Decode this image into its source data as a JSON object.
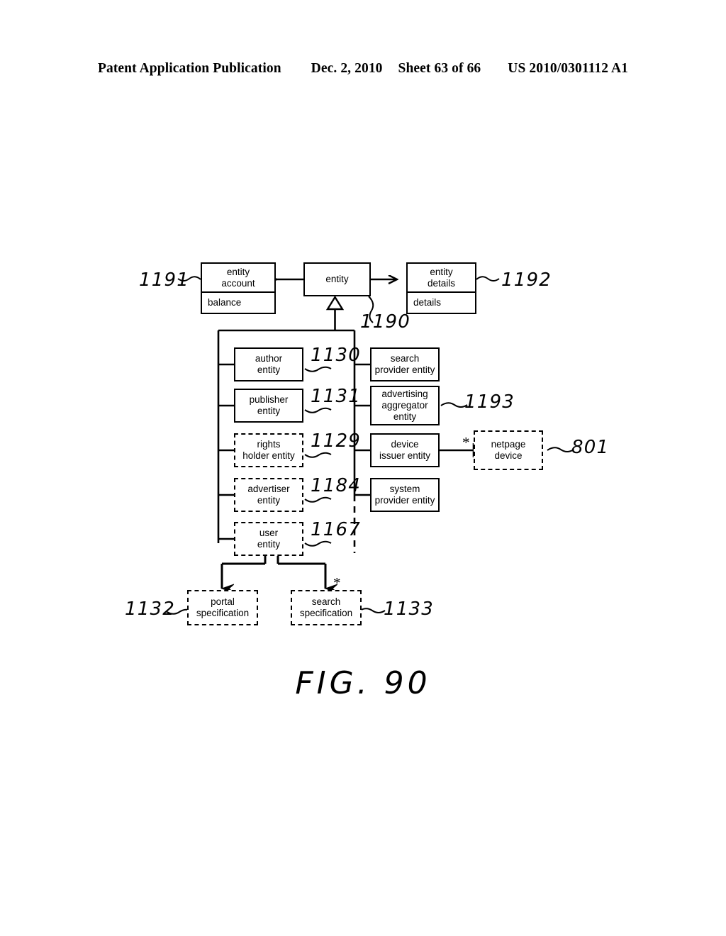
{
  "page_header": {
    "publication": "Patent Application Publication",
    "date": "Dec. 2, 2010",
    "sheet": "Sheet 63 of 66",
    "doc_number": "US 2010/0301112 A1"
  },
  "figure": {
    "caption": "FIG. 90",
    "type": "uml-class-diagram",
    "nodes": [
      {
        "id": "entity_account",
        "name": "entity\naccount",
        "attribute": "balance",
        "ref": "1191",
        "style": "solid",
        "compartments": 2
      },
      {
        "id": "entity",
        "name": "entity",
        "ref": "1190",
        "style": "solid",
        "compartments": 1
      },
      {
        "id": "entity_details",
        "name": "entity\ndetails",
        "attribute": "details",
        "ref": "1192",
        "style": "solid",
        "compartments": 2
      },
      {
        "id": "author_entity",
        "name": "author\nentity",
        "ref": "1130",
        "style": "solid",
        "compartments": 1
      },
      {
        "id": "publisher_entity",
        "name": "publisher\nentity",
        "ref": "1131",
        "style": "solid",
        "compartments": 1
      },
      {
        "id": "rights_holder_entity",
        "name": "rights\nholder entity",
        "ref": "1129",
        "style": "dashed",
        "compartments": 1
      },
      {
        "id": "advertiser_entity",
        "name": "advertiser\nentity",
        "ref": "1184",
        "style": "dashed",
        "compartments": 1
      },
      {
        "id": "user_entity",
        "name": "user\nentity",
        "ref": "1167",
        "style": "dashed",
        "compartments": 1
      },
      {
        "id": "search_provider_entity",
        "name": "search\nprovider entity",
        "ref": "",
        "style": "solid",
        "compartments": 1
      },
      {
        "id": "advertising_aggregator_entity",
        "name": "advertising\naggregator\nentity",
        "ref": "1193",
        "style": "solid",
        "compartments": 1
      },
      {
        "id": "device_issuer_entity",
        "name": "device\nissuer entity",
        "ref": "",
        "style": "solid",
        "compartments": 1
      },
      {
        "id": "netpage_device",
        "name": "netpage\ndevice",
        "ref": "801",
        "style": "dashed",
        "compartments": 1
      },
      {
        "id": "system_provider_entity",
        "name": "system\nprovider entity",
        "ref": "",
        "style": "solid",
        "compartments": 1
      },
      {
        "id": "portal_specification",
        "name": "portal\nspecification",
        "ref": "1132",
        "style": "dashed",
        "compartments": 1
      },
      {
        "id": "search_specification",
        "name": "search\nspecification",
        "ref": "1133",
        "style": "dashed",
        "compartments": 1
      }
    ],
    "multiplicities": [
      {
        "id": "netpage_device_star",
        "label": "*"
      },
      {
        "id": "search_specification_star",
        "label": "*"
      }
    ],
    "relationships": [
      {
        "from": "entity",
        "to": "entity_account",
        "kind": "association-arrow"
      },
      {
        "from": "entity",
        "to": "entity_details",
        "kind": "association-arrow"
      },
      {
        "from": "entity",
        "to": "subtype-group",
        "kind": "generalization"
      },
      {
        "from": "device_issuer_entity",
        "to": "netpage_device",
        "kind": "association"
      },
      {
        "from": "user_entity",
        "to": "portal_specification",
        "kind": "composition-arrow"
      },
      {
        "from": "user_entity",
        "to": "search_specification",
        "kind": "composition-arrow"
      }
    ]
  }
}
